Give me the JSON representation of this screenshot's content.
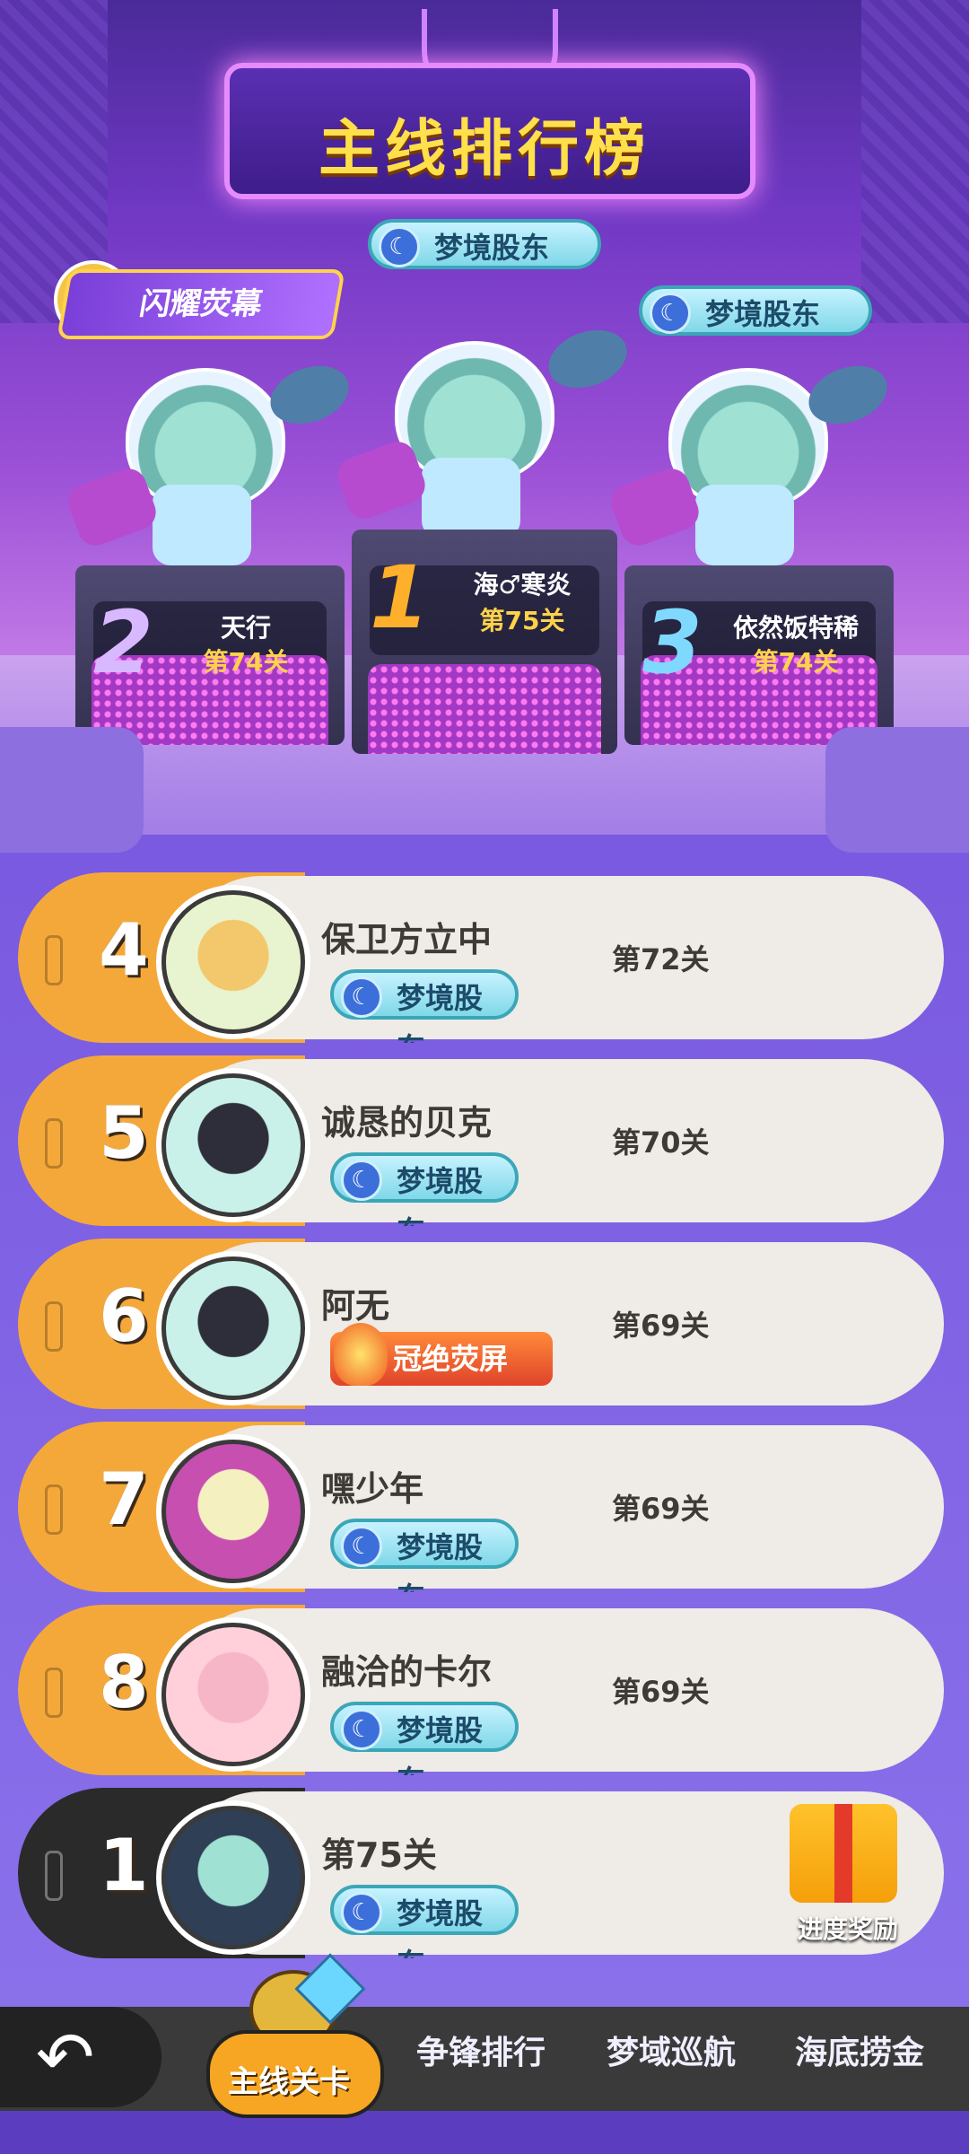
{
  "header": {
    "title": "主线排行榜"
  },
  "top_badges": {
    "shine_title": "闪耀荧幕",
    "dream_badge": "梦境股东"
  },
  "podium": [
    {
      "rank": "2",
      "name": "天行",
      "level": "第74关"
    },
    {
      "rank": "1",
      "name": "海♂寒炎",
      "level": "第75关"
    },
    {
      "rank": "3",
      "name": "依然饭特稀",
      "level": "第74关"
    }
  ],
  "ranking": [
    {
      "rank": "4",
      "name": "保卫方立中",
      "badge": "梦境股东",
      "level": "第72关"
    },
    {
      "rank": "5",
      "name": "诚恳的贝克",
      "badge": "梦境股东",
      "level": "第70关"
    },
    {
      "rank": "6",
      "name": "阿无",
      "badge": "冠绝荧屏",
      "level": "第69关"
    },
    {
      "rank": "7",
      "name": "嘿少年",
      "badge": "梦境股东",
      "level": "第69关"
    },
    {
      "rank": "8",
      "name": "融洽的卡尔",
      "badge": "梦境股东",
      "level": "第69关"
    }
  ],
  "me": {
    "rank": "1",
    "level": "第75关",
    "badge": "梦境股东",
    "reward_label": "进度奖励"
  },
  "nav": {
    "back_icon": "back-arrow-icon",
    "tabs": [
      "主线关卡",
      "争锋排行",
      "梦域巡航",
      "海底捞金"
    ]
  },
  "colors": {
    "row_orange": "#f5a83a",
    "row_me": "#2a2a2a",
    "badge_teal": "#7fd8e8",
    "gold_text": "#ffe04a"
  }
}
